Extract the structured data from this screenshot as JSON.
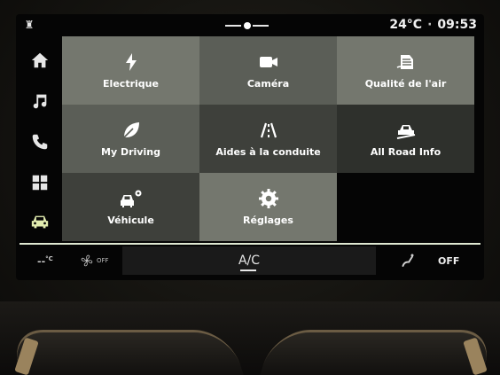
{
  "status_bar": {
    "logo": "♜",
    "temperature": "24°C",
    "separator": "·",
    "time": "09:53"
  },
  "side_nav": {
    "items": [
      {
        "name": "home",
        "icon": "home-icon"
      },
      {
        "name": "music",
        "icon": "music-note-icon"
      },
      {
        "name": "phone",
        "icon": "phone-icon"
      },
      {
        "name": "apps",
        "icon": "apps-grid-icon"
      },
      {
        "name": "vehicle",
        "icon": "car-icon",
        "active": true
      }
    ],
    "active_color": "#e2ecb0"
  },
  "tiles": [
    {
      "label": "Electrique",
      "icon": "lightning-icon"
    },
    {
      "label": "Caméra",
      "icon": "camera-icon"
    },
    {
      "label": "Qualité de l'air",
      "icon": "air-quality-icon"
    },
    {
      "label": "My Driving",
      "icon": "leaf-icon"
    },
    {
      "label": "Aides à la conduite",
      "icon": "lane-assist-icon"
    },
    {
      "label": "All Road Info",
      "icon": "off-road-icon"
    },
    {
      "label": "Véhicule",
      "icon": "car-settings-icon"
    },
    {
      "label": "Réglages",
      "icon": "gear-icon"
    }
  ],
  "climate_bar": {
    "left_temp": "--",
    "left_temp_unit": "°C",
    "fan_state": "OFF",
    "ac_label": "A/C",
    "right_state": "OFF"
  }
}
